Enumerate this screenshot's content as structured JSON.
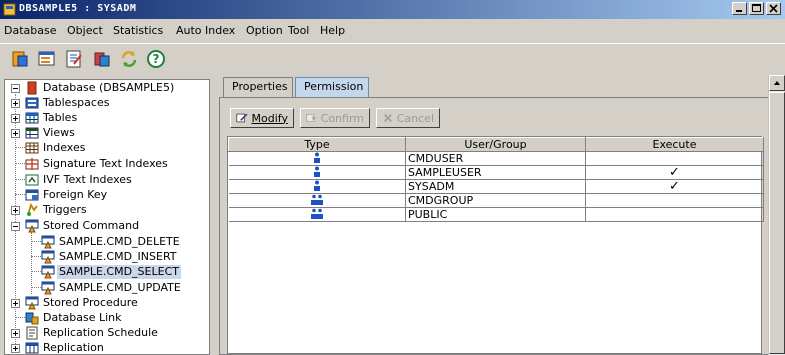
{
  "window": {
    "title": "DBSAMPLE5 : SYSADM",
    "minimize": "_",
    "maximize": "□",
    "close": "×"
  },
  "menu": [
    {
      "label": "Database"
    },
    {
      "label": "Object"
    },
    {
      "label": "Statistics"
    },
    {
      "label": "Auto Index"
    },
    {
      "label": "Option"
    },
    {
      "label": "Tool"
    },
    {
      "label": "Help"
    }
  ],
  "toolbar": {
    "icons": [
      "connect-icon",
      "properties-icon",
      "edit-icon",
      "transfer-icon",
      "refresh-icon",
      "help-icon"
    ],
    "help_glyph": "?"
  },
  "tree": {
    "items": [
      {
        "label": "Database (DBSAMPLE5)",
        "icon": "database-icon",
        "expander": "minus"
      },
      {
        "label": "Tablespaces",
        "icon": "tablespace-icon",
        "expander": "plus"
      },
      {
        "label": "Tables",
        "icon": "table-icon",
        "expander": "plus"
      },
      {
        "label": "Views",
        "icon": "view-icon",
        "expander": "plus"
      },
      {
        "label": "Indexes",
        "icon": "index-icon",
        "expander": ""
      },
      {
        "label": "Signature Text Indexes",
        "icon": "signature-index-icon",
        "expander": ""
      },
      {
        "label": "IVF Text Indexes",
        "icon": "ivf-index-icon",
        "expander": ""
      },
      {
        "label": "Foreign Key",
        "icon": "foreign-key-icon",
        "expander": ""
      },
      {
        "label": "Triggers",
        "icon": "trigger-icon",
        "expander": "plus"
      },
      {
        "label": "Stored Command",
        "icon": "stored-command-icon",
        "expander": "minus"
      },
      {
        "label": "SAMPLE.CMD_DELETE",
        "icon": "command-icon",
        "expander": ""
      },
      {
        "label": "SAMPLE.CMD_INSERT",
        "icon": "command-icon",
        "expander": ""
      },
      {
        "label": "SAMPLE.CMD_SELECT",
        "icon": "command-icon",
        "expander": "",
        "selected": true
      },
      {
        "label": "SAMPLE.CMD_UPDATE",
        "icon": "command-icon",
        "expander": ""
      },
      {
        "label": "Stored Procedure",
        "icon": "stored-procedure-icon",
        "expander": "plus"
      },
      {
        "label": "Database Link",
        "icon": "database-link-icon",
        "expander": ""
      },
      {
        "label": "Replication Schedule",
        "icon": "replication-schedule-icon",
        "expander": "plus"
      },
      {
        "label": "Replication",
        "icon": "replication-icon",
        "expander": "plus"
      }
    ]
  },
  "tabs": [
    {
      "label": "Properties",
      "active": false
    },
    {
      "label": "Permission",
      "active": true
    }
  ],
  "actions": {
    "modify": "Modify",
    "confirm": "Confirm",
    "cancel": "Cancel"
  },
  "grid": {
    "columns": [
      "Type",
      "User/Group",
      "Execute"
    ],
    "rows": [
      {
        "type": "user",
        "name": "CMDUSER",
        "execute": ""
      },
      {
        "type": "user",
        "name": "SAMPLEUSER",
        "execute": "✓"
      },
      {
        "type": "user",
        "name": "SYSADM",
        "execute": "✓"
      },
      {
        "type": "group",
        "name": "CMDGROUP",
        "execute": ""
      },
      {
        "type": "group",
        "name": "PUBLIC",
        "execute": ""
      }
    ]
  },
  "colors": {
    "titlebar_start": "#0a246a",
    "titlebar_end": "#a6caf0",
    "tab_active": "#c4d8ec",
    "selection": "#c9d7e8",
    "user_icon": "#1e50c8"
  }
}
